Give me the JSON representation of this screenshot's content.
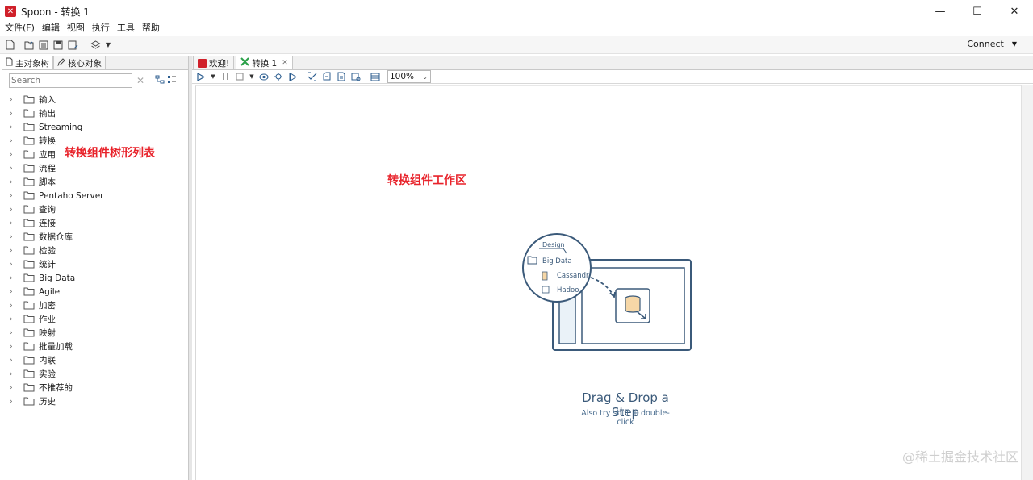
{
  "window": {
    "title": "Spoon - 转换 1",
    "logo": "spoon-logo",
    "controls": {
      "minimize": "—",
      "maximize": "☐",
      "close": "✕"
    }
  },
  "menu": [
    "文件(F)",
    "编辑",
    "视图",
    "执行",
    "工具",
    "帮助"
  ],
  "toolbar": {
    "connect_label": "Connect"
  },
  "left": {
    "tabs": [
      "主对象树",
      "核心对象"
    ],
    "search_placeholder": "Search",
    "tree": [
      "输入",
      "输出",
      "Streaming",
      "转换",
      "应用",
      "流程",
      "脚本",
      "Pentaho Server",
      "查询",
      "连接",
      "数据仓库",
      "检验",
      "统计",
      "Big Data",
      "Agile",
      "加密",
      "作业",
      "映射",
      "批量加载",
      "内联",
      "实验",
      "不推荐的",
      "历史"
    ],
    "annotation": "转换组件树形列表"
  },
  "right": {
    "tabs": [
      "欢迎!",
      "转换 1"
    ],
    "zoom": "100%",
    "annotation": "转换组件工作区",
    "illustration": {
      "design_tab": "Design",
      "folder": "Big Data",
      "item1": "Cassandr",
      "item2": "Hadoo"
    },
    "dd_title": "Drag & Drop a Step",
    "dd_sub": "Also try shift + double-click"
  },
  "watermark": "@稀土掘金技术社区",
  "colors": {
    "brand_red": "#d0202a",
    "annotation_red": "#e8232b",
    "illustration_blue": "#3b5a7a"
  }
}
